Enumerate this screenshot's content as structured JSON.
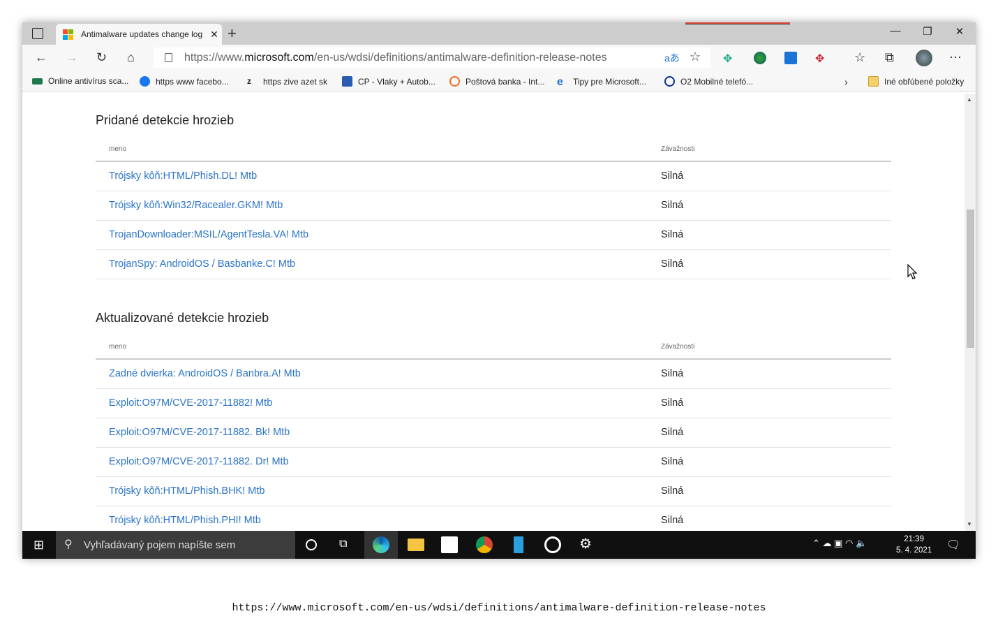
{
  "browser": {
    "tab_title": "Antimalware updates change log",
    "url_prefix": "https://www.",
    "url_domain": "microsoft.com",
    "url_path": "/en-us/wdsi/definitions/antimalware-definition-release-notes",
    "bookmarks": [
      {
        "label": "Online antivírus sca...",
        "color": "#1e7a4a"
      },
      {
        "label": "https   www facebo...",
        "color": "#1877f2"
      },
      {
        "label": "https   zive azet sk",
        "color": "#222"
      },
      {
        "label": "CP - Vlaky + Autob...",
        "color": "#2a5db0"
      },
      {
        "label": "Poštová banka - Int...",
        "color": "#f26b21"
      },
      {
        "label": "Tipy pre Microsoft...",
        "color": "#1f6fd1"
      },
      {
        "label": "O2   Mobilné telefó...",
        "color": "#0a2d8f"
      }
    ],
    "other_favorites": "Iné obľúbené položky"
  },
  "page": {
    "added": {
      "title": "Pridané detekcie hrozieb",
      "col_name": "meno",
      "col_severity": "Závažnosti",
      "rows": [
        {
          "name": "Trójsky kôň:HTML/Phish.DL! Mtb",
          "severity": "Silná"
        },
        {
          "name": "Trójsky kôň:Win32/Racealer.GKM! Mtb",
          "severity": "Silná"
        },
        {
          "name": "TrojanDownloader:MSIL/AgentTesla.VA! Mtb",
          "severity": "Silná"
        },
        {
          "name": "TrojanSpy: AndroidOS / Basbanke.C! Mtb",
          "severity": "Silná"
        }
      ]
    },
    "updated": {
      "title": "Aktualizované detekcie hrozieb",
      "col_name": "meno",
      "col_severity": "Závažnosti",
      "rows": [
        {
          "name": "Zadné dvierka: AndroidOS / Banbra.A! Mtb",
          "severity": "Silná"
        },
        {
          "name": "Exploit:O97M/CVE-2017-11882! Mtb",
          "severity": "Silná"
        },
        {
          "name": "Exploit:O97M/CVE-2017-11882. Bk! Mtb",
          "severity": "Silná"
        },
        {
          "name": "Exploit:O97M/CVE-2017-11882. Dr! Mtb",
          "severity": "Silná"
        },
        {
          "name": "Trójsky kôň:HTML/Phish.BHK! Mtb",
          "severity": "Silná"
        },
        {
          "name": "Trójsky kôň:HTML/Phish.PHI! Mtb",
          "severity": "Silná"
        }
      ]
    }
  },
  "taskbar": {
    "search_placeholder": "Vyhľadávaný pojem napíšte sem",
    "time": "21:39",
    "date": "5. 4. 2021"
  },
  "caption": "https://www.microsoft.com/en-us/wdsi/definitions/antimalware-definition-release-notes"
}
